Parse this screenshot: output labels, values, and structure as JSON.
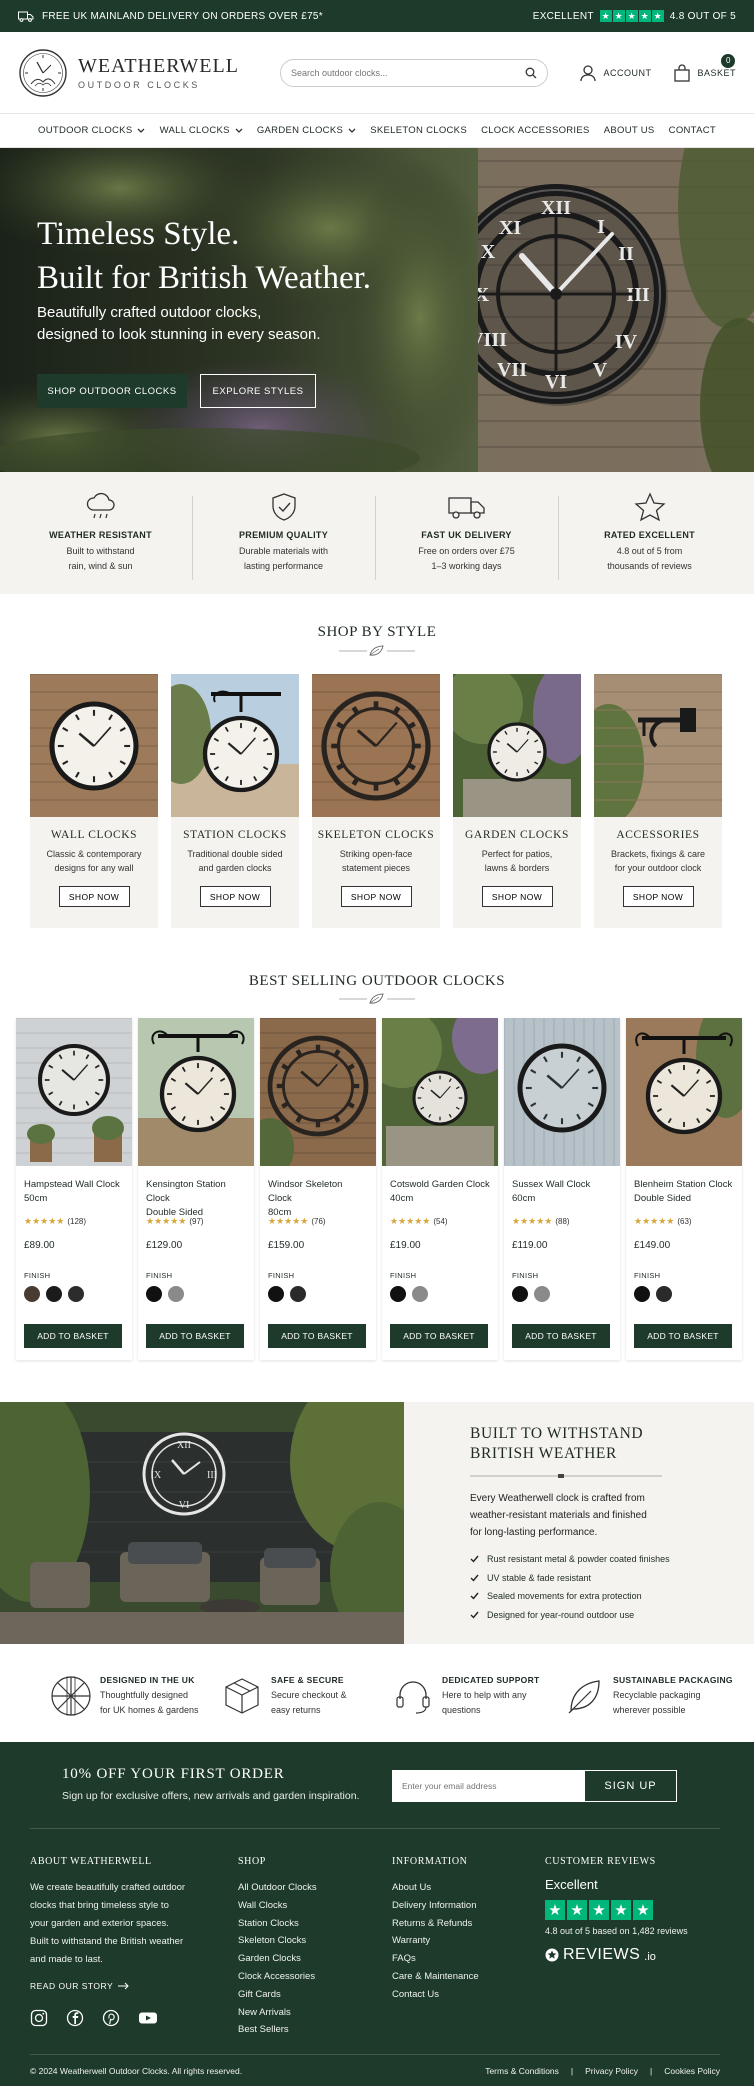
{
  "topbar": {
    "delivery": "FREE UK MAINLAND DELIVERY ON ORDERS OVER £75*",
    "excellent": "EXCELLENT",
    "rating": "4.8 OUT OF 5"
  },
  "header": {
    "logo_name": "WEATHERWELL",
    "logo_sub": "OUTDOOR CLOCKS",
    "search_placeholder": "Search outdoor clocks...",
    "account": "ACCOUNT",
    "basket": "BASKET",
    "basket_count": "0"
  },
  "nav": [
    {
      "label": "OUTDOOR CLOCKS",
      "dropdown": true
    },
    {
      "label": "WALL CLOCKS",
      "dropdown": true
    },
    {
      "label": "GARDEN CLOCKS",
      "dropdown": true
    },
    {
      "label": "SKELETON CLOCKS",
      "dropdown": false
    },
    {
      "label": "CLOCK ACCESSORIES",
      "dropdown": false
    },
    {
      "label": "ABOUT US",
      "dropdown": false
    },
    {
      "label": "CONTACT",
      "dropdown": false
    }
  ],
  "hero": {
    "title_line1": "Timeless Style.",
    "title_line2": "Built for British Weather.",
    "sub_line1": "Beautifully crafted outdoor clocks,",
    "sub_line2": "designed to look stunning in every season.",
    "primary_cta": "SHOP OUTDOOR CLOCKS",
    "secondary_cta": "EXPLORE STYLES"
  },
  "features": [
    {
      "icon": "cloud-rain-icon",
      "title": "WEATHER RESISTANT",
      "line1": "Built to withstand",
      "line2": "rain, wind & sun"
    },
    {
      "icon": "shield-check-icon",
      "title": "PREMIUM QUALITY",
      "line1": "Durable materials with",
      "line2": "lasting performance"
    },
    {
      "icon": "truck-icon",
      "title": "FAST UK DELIVERY",
      "line1": "Free on orders over £75",
      "line2": "1–3 working days"
    },
    {
      "icon": "star-outline-icon",
      "title": "RATED EXCELLENT",
      "line1": "4.8 out of 5 from",
      "line2": "thousands of reviews"
    }
  ],
  "shop_by_style": {
    "title": "SHOP BY STYLE",
    "cards": [
      {
        "name": "WALL CLOCKS",
        "line1": "Classic & contemporary",
        "line2": "designs for any wall",
        "button": "SHOP NOW"
      },
      {
        "name": "STATION CLOCKS",
        "line1": "Traditional double sided",
        "line2": "and garden clocks",
        "button": "SHOP NOW"
      },
      {
        "name": "SKELETON CLOCKS",
        "line1": "Striking open-face",
        "line2": "statement pieces",
        "button": "SHOP NOW"
      },
      {
        "name": "GARDEN CLOCKS",
        "line1": "Perfect for patios,",
        "line2": "lawns & borders",
        "button": "SHOP NOW"
      },
      {
        "name": "ACCESSORIES",
        "line1": "Brackets, fixings & care",
        "line2": "for your outdoor clock",
        "button": "SHOP NOW"
      }
    ]
  },
  "best_selling": {
    "title": "BEST SELLING OUTDOOR CLOCKS",
    "finish_label": "FINISH",
    "products": [
      {
        "line1": "Hampstead Wall Clock",
        "line2": "50cm",
        "reviews": "(128)",
        "price": "£89.00",
        "finishes": [
          "#4a3b30",
          "#1b1b1b",
          "#2c2c2c"
        ],
        "button": "ADD TO BASKET"
      },
      {
        "line1": "Kensington Station Clock",
        "line2": "Double Sided",
        "reviews": "(97)",
        "price": "£129.00",
        "finishes": [
          "#111111",
          "#8a8a8a"
        ],
        "button": "ADD TO BASKET"
      },
      {
        "line1": "Windsor Skeleton Clock",
        "line2": "80cm",
        "reviews": "(76)",
        "price": "£159.00",
        "finishes": [
          "#111111",
          "#2a2a2a"
        ],
        "button": "ADD TO BASKET"
      },
      {
        "line1": "Cotswold Garden Clock",
        "line2": "40cm",
        "reviews": "(54)",
        "price": "£19.00",
        "finishes": [
          "#111111",
          "#8a8a8a"
        ],
        "button": "ADD TO BASKET"
      },
      {
        "line1": "Sussex Wall Clock",
        "line2": "60cm",
        "reviews": "(88)",
        "price": "£119.00",
        "finishes": [
          "#111111",
          "#8a8a8a"
        ],
        "button": "ADD TO BASKET"
      },
      {
        "line1": "Blenheim Station Clock",
        "line2": "Double Sided",
        "reviews": "(63)",
        "price": "£149.00",
        "finishes": [
          "#111111",
          "#2a2a2a"
        ],
        "button": "ADD TO BASKET"
      }
    ]
  },
  "built": {
    "title_line1": "BUILT TO WITHSTAND",
    "title_line2": "BRITISH WEATHER",
    "p_line1": "Every Weatherwell clock is crafted from",
    "p_line2": "weather-resistant materials and finished",
    "p_line3": "for long-lasting performance.",
    "bullets": [
      "Rust resistant metal & powder coated finishes",
      "UV stable & fade resistant",
      "Sealed movements for extra protection",
      "Designed for year-round outdoor use"
    ]
  },
  "trust": [
    {
      "icon": "union-jack-icon",
      "title": "DESIGNED IN THE UK",
      "line1": "Thoughtfully designed",
      "line2": "for UK homes & gardens"
    },
    {
      "icon": "box-icon",
      "title": "SAFE & SECURE",
      "line1": "Secure checkout &",
      "line2": "easy returns"
    },
    {
      "icon": "headset-icon",
      "title": "DEDICATED SUPPORT",
      "line1": "Here to help with any",
      "line2": "questions"
    },
    {
      "icon": "leaf-icon",
      "title": "SUSTAINABLE PACKAGING",
      "line1": "Recyclable packaging",
      "line2": "wherever possible"
    }
  ],
  "newsletter": {
    "title": "10% OFF YOUR FIRST ORDER",
    "sub": "Sign up for exclusive offers, new arrivals and garden inspiration.",
    "placeholder": "Enter your email address",
    "button": "SIGN UP"
  },
  "footer": {
    "about_title": "ABOUT WEATHERWELL",
    "about_lines": [
      "We create beautifully crafted outdoor",
      "clocks that bring timeless style to",
      "your garden and exterior spaces.",
      "Built to withstand the British weather",
      "and made to last."
    ],
    "story": "READ OUR STORY",
    "shop_title": "SHOP",
    "shop_links": [
      "All Outdoor Clocks",
      "Wall Clocks",
      "Station Clocks",
      "Skeleton Clocks",
      "Garden Clocks",
      "Clock Accessories",
      "Gift Cards",
      "New Arrivals",
      "Best Sellers"
    ],
    "info_title": "INFORMATION",
    "info_links": [
      "About Us",
      "Delivery Information",
      "Returns & Refunds",
      "Warranty",
      "FAQs",
      "Care & Maintenance",
      "Contact Us"
    ],
    "reviews_title": "CUSTOMER REVIEWS",
    "reviews_excellent": "Excellent",
    "reviews_summary": "4.8 out of 5 based on 1,482 reviews",
    "reviews_brand": "REVIEWS",
    "reviews_tld": ".io",
    "copyright": "© 2024 Weatherwell Outdoor Clocks. All rights reserved.",
    "legal": [
      "Terms & Conditions",
      "Privacy Policy",
      "Cookies Policy"
    ]
  },
  "colors": {
    "brand_green": "#1e3a2b",
    "cream": "#f5f3ef",
    "trustpilot": "#00b67a",
    "star_gold": "#d9a53a"
  }
}
